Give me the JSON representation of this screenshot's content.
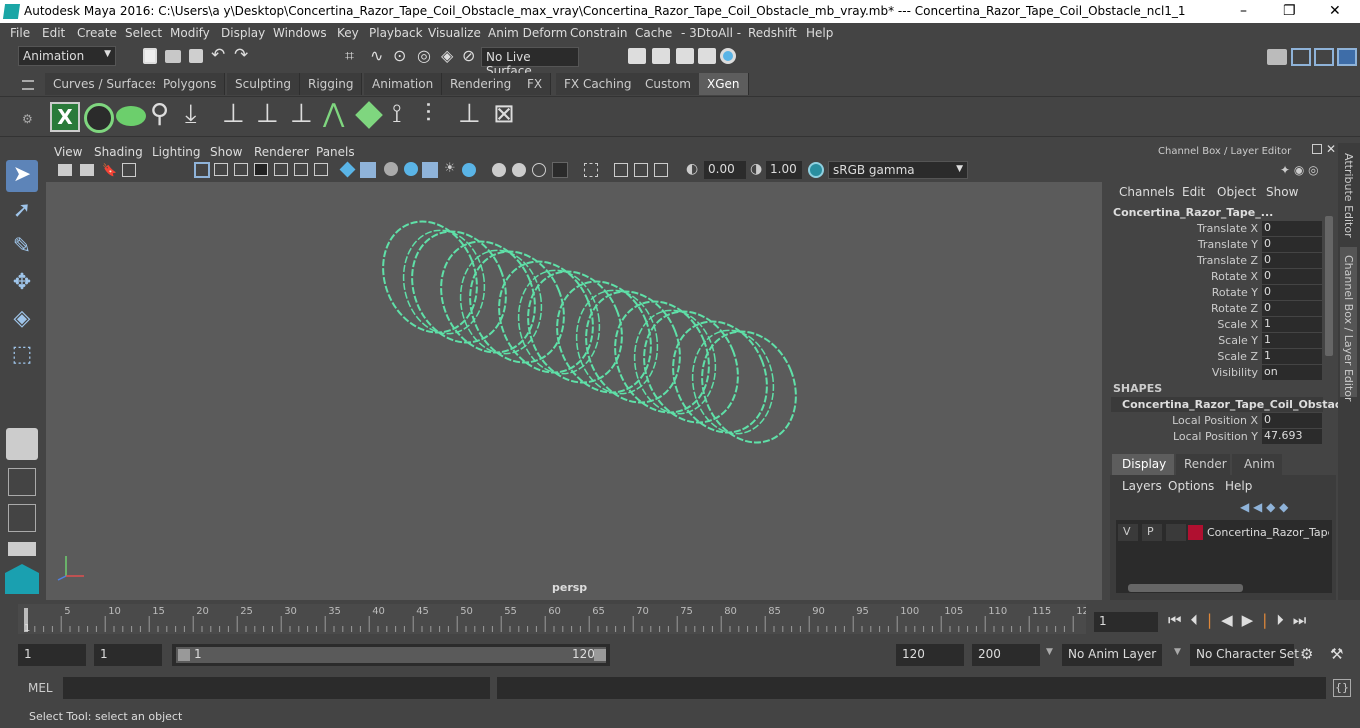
{
  "window": {
    "title": "Autodesk Maya 2016: C:\\Users\\a y\\Desktop\\Concertina_Razor_Tape_Coil_Obstacle_max_vray\\Concertina_Razor_Tape_Coil_Obstacle_mb_vray.mb*   ---   Concertina_Razor_Tape_Coil_Obstacle_ncl1_1",
    "minimize": "–",
    "restore": "❐",
    "close": "✕"
  },
  "menubar": [
    "File",
    "Edit",
    "Create",
    "Select",
    "Modify",
    "Display",
    "Windows",
    "Key",
    "Playback",
    "Visualize",
    "Anim Deform",
    "Constrain",
    "Cache",
    "- 3DtoAll -",
    "Redshift",
    "Help"
  ],
  "statusline": {
    "menuset": "Animation",
    "live_surface": "No Live Surface"
  },
  "shelf_tabs": [
    "Curves / Surfaces",
    "Polygons",
    "Sculpting",
    "Rigging",
    "Animation",
    "Rendering",
    "FX",
    "FX Caching",
    "Custom",
    "XGen"
  ],
  "active_shelf_tab": "XGen",
  "viewport": {
    "menus": [
      "View",
      "Shading",
      "Lighting",
      "Show",
      "Renderer",
      "Panels"
    ],
    "exposure": "0.00",
    "gamma": "1.00",
    "color_space": "sRGB gamma",
    "camera_label": "persp"
  },
  "channel_box": {
    "header": "Channel Box / Layer Editor",
    "menus": [
      "Channels",
      "Edit",
      "Object",
      "Show"
    ],
    "object_name": "Concertina_Razor_Tape_...",
    "channels": [
      {
        "label": "Translate X",
        "value": "0"
      },
      {
        "label": "Translate Y",
        "value": "0"
      },
      {
        "label": "Translate Z",
        "value": "0"
      },
      {
        "label": "Rotate X",
        "value": "0"
      },
      {
        "label": "Rotate Y",
        "value": "0"
      },
      {
        "label": "Rotate Z",
        "value": "0"
      },
      {
        "label": "Scale X",
        "value": "1"
      },
      {
        "label": "Scale Y",
        "value": "1"
      },
      {
        "label": "Scale Z",
        "value": "1"
      },
      {
        "label": "Visibility",
        "value": "on"
      }
    ],
    "shapes_header": "SHAPES",
    "shape_name": "Concertina_Razor_Tape_Coil_Obstacl...",
    "shape_channels": [
      {
        "label": "Local Position X",
        "value": "0"
      },
      {
        "label": "Local Position Y",
        "value": "47.693"
      }
    ]
  },
  "layer_editor": {
    "tabs": [
      "Display",
      "Render",
      "Anim"
    ],
    "active_tab": "Display",
    "menus": [
      "Layers",
      "Options",
      "Help"
    ],
    "layer": {
      "v": "V",
      "p": "P",
      "name": "Concertina_Razor_Tape_",
      "color": "#b01030"
    }
  },
  "side_tabs": [
    "Attribute Editor",
    "Channel Box / Layer Editor"
  ],
  "timeline": {
    "ticks": [
      "5",
      "10",
      "15",
      "20",
      "25",
      "30",
      "35",
      "40",
      "45",
      "50",
      "55",
      "60",
      "65",
      "70",
      "75",
      "80",
      "85",
      "90",
      "95",
      "100",
      "105",
      "110",
      "115",
      "12"
    ],
    "current_frame_marker": "1",
    "current_frame": "1"
  },
  "range": {
    "start": "1",
    "playback_start": "1",
    "slider_start": "1",
    "slider_end": "120",
    "playback_end": "120",
    "end": "200",
    "anim_layer": "No Anim Layer",
    "character_set": "No Character Set"
  },
  "command_line": {
    "label": "MEL"
  },
  "help_line": "Select Tool: select an object",
  "colors": {
    "curve": "#5fe0a8",
    "viewport_bg": "#5b5b5b",
    "accent_blue": "#3e6da8"
  }
}
